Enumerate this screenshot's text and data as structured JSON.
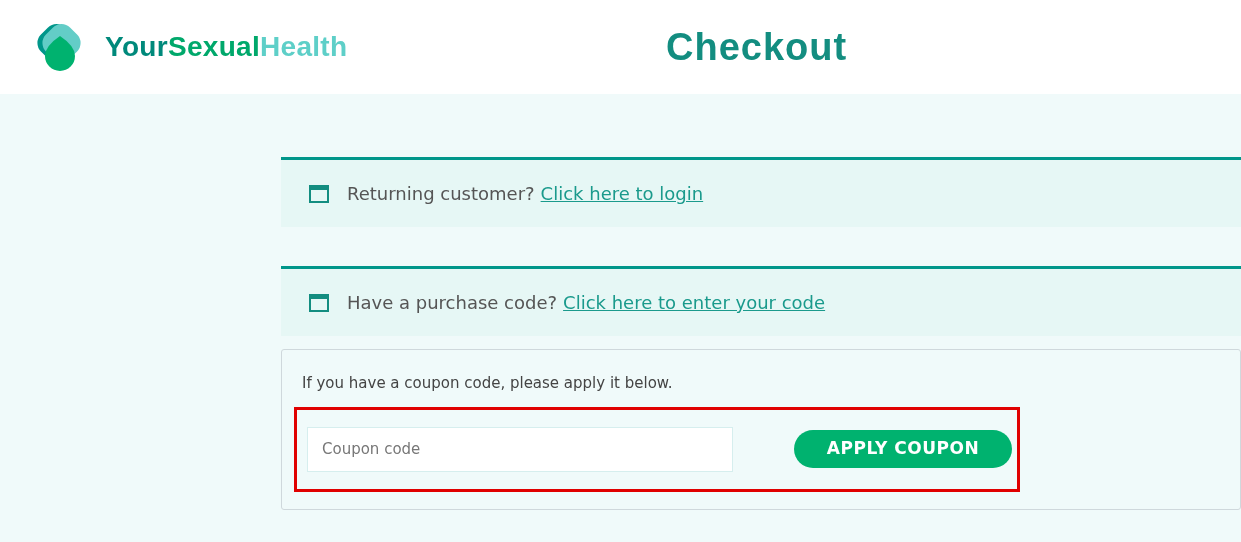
{
  "header": {
    "logo": {
      "parts": [
        {
          "text": "Your",
          "color": "#00897b"
        },
        {
          "text": "Sexual",
          "color": "#00a86b"
        },
        {
          "text": "Health",
          "color": "#5ecfc8"
        }
      ]
    },
    "title": "Checkout"
  },
  "notices": [
    {
      "text": "Returning customer?",
      "link": "Click here to login"
    },
    {
      "text": "Have a purchase code?",
      "link": "Click here to enter your code"
    }
  ],
  "coupon": {
    "intro": "If you have a coupon code, please apply it below.",
    "placeholder": "Coupon code",
    "button": "APPLY COUPON",
    "highlighted": true
  }
}
